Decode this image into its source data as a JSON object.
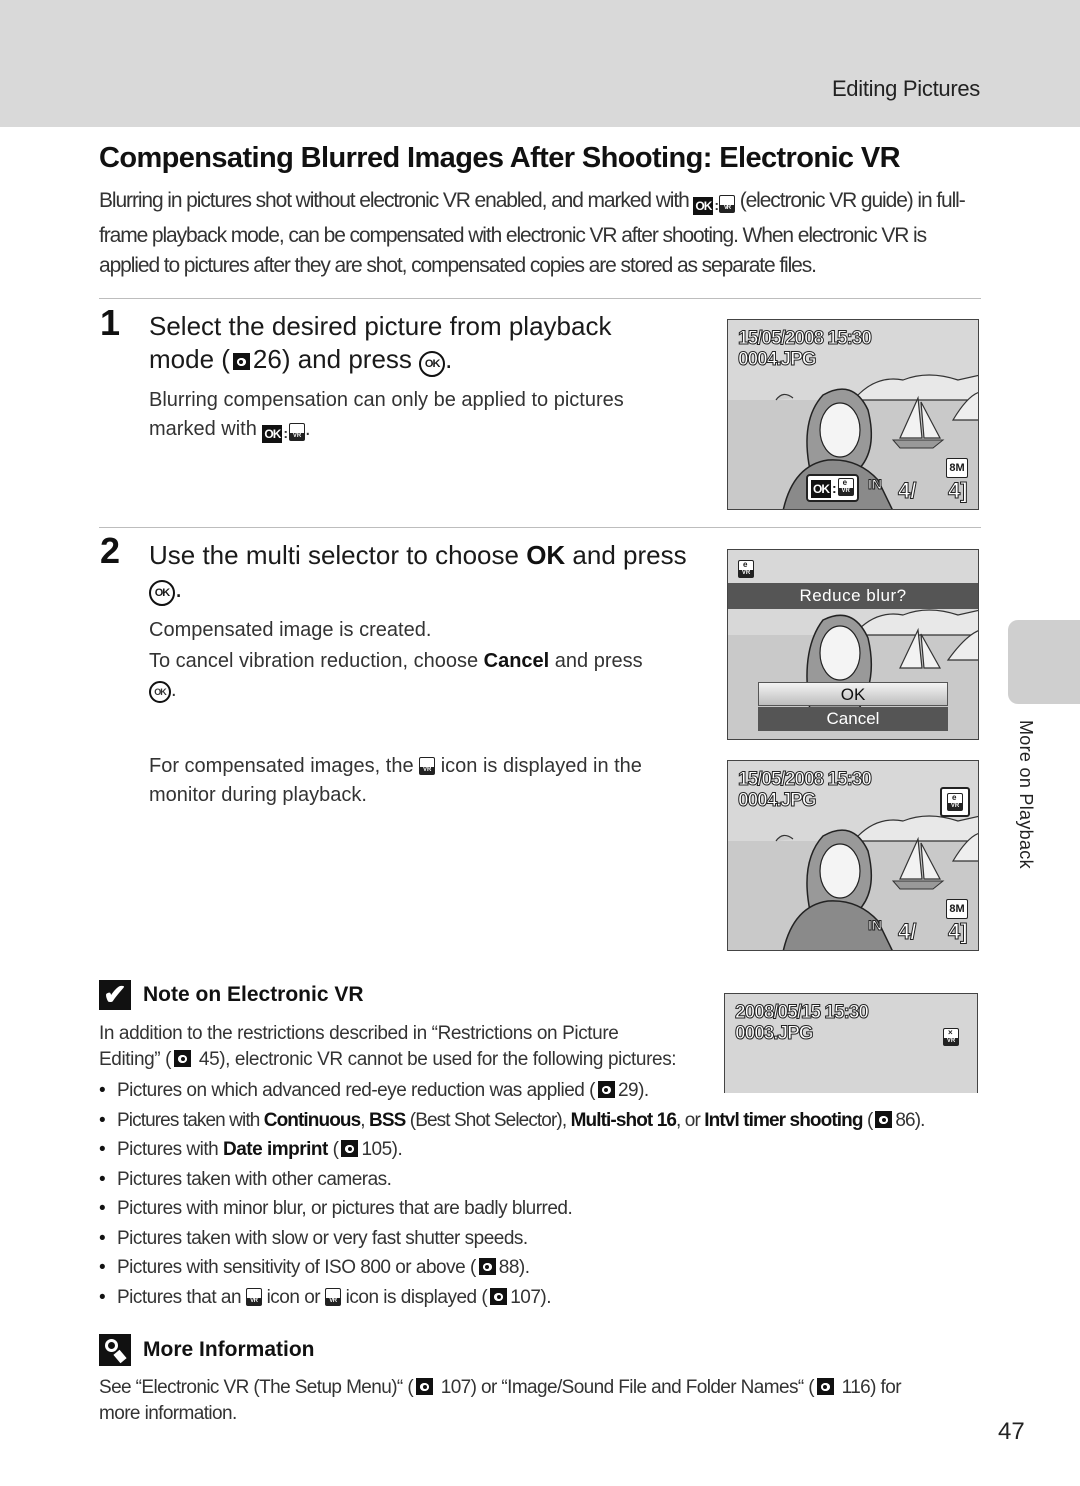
{
  "header": {
    "section": "Editing Pictures"
  },
  "title": "Compensating Blurred Images After Shooting: Electronic VR",
  "intro": {
    "part1": "Blurring in pictures shot without electronic VR enabled, and marked with ",
    "part2": " (electronic VR guide) in full-frame playback mode, can be compensated with electronic VR after shooting. When electronic VR is applied to pictures after they are shot, compensated copies are stored as separate files."
  },
  "icons": {
    "ok_label": "OK",
    "ok_button": "OK",
    "colon": ":"
  },
  "step1": {
    "number": "1",
    "title_a": "Select the desired picture from playback",
    "title_b": "mode (",
    "title_ref": "26",
    "title_c": ") and press ",
    "title_d": ".",
    "text_a": "Blurring compensation can only be applied to pictures",
    "text_b": "marked with ",
    "text_c": "."
  },
  "step2": {
    "number": "2",
    "title_a": "Use the multi selector to choose ",
    "title_bold": "OK",
    "title_b": " and press",
    "title_end": ".",
    "line1": "Compensated image is created.",
    "line2_a": "To cancel vibration reduction, choose ",
    "line2_bold": "Cancel",
    "line2_b": " and press",
    "line2_end": ".",
    "line3_a": "For compensated images, the ",
    "line3_b": " icon is displayed in the",
    "line3_c": "monitor during playback."
  },
  "screens": {
    "screen1": {
      "datetime": "15/05/2008 15:30",
      "filename": "0004.JPG",
      "size": "8M",
      "memory": "IN",
      "counter_current": "4/",
      "counter_total": "4]"
    },
    "screen2": {
      "prompt": "Reduce blur?",
      "options": [
        "OK",
        "Cancel"
      ],
      "selected": "OK"
    },
    "screen3": {
      "datetime": "15/05/2008 15:30",
      "filename": "0004.JPG",
      "size": "8M",
      "memory": "IN",
      "counter_current": "4/",
      "counter_total": "4]"
    },
    "screen4": {
      "datetime": "2008/05/15 15:30",
      "filename": "0003.JPG"
    }
  },
  "note": {
    "heading": "Note on Electronic VR",
    "intro_1": "In addition to the restrictions described in “Restrictions on Picture",
    "intro_2a": "Editing” (",
    "intro_2b": " 45), electronic VR cannot be used for the following pictures:",
    "bullets": [
      {
        "a": "Pictures on which advanced red-eye reduction was applied (",
        "ref": "29",
        "b": ")."
      },
      {
        "a": "Pictures taken with ",
        "b1": "Continuous",
        "c": ", ",
        "b2": "BSS",
        "d": " (Best Shot Selector), ",
        "b3": "Multi-shot 16",
        "e": ", or ",
        "b4": "Intvl timer shooting",
        "f": " (",
        "ref": "86",
        "g": ")."
      },
      {
        "a": "Pictures with ",
        "b1": "Date imprint",
        "c": " (",
        "ref": "105",
        "d": ")."
      },
      {
        "a": "Pictures taken with other cameras."
      },
      {
        "a": "Pictures with minor blur, or pictures that are badly blurred."
      },
      {
        "a": "Pictures taken with slow or very fast shutter speeds."
      },
      {
        "a": "Pictures with sensitivity of ISO 800 or above (",
        "ref": "88",
        "b": ")."
      },
      {
        "a": "Pictures that an ",
        "b": " icon or ",
        "c": " icon is displayed (",
        "ref": "107",
        "d": ")."
      }
    ]
  },
  "more_info": {
    "heading": "More Information",
    "line1_a": "See “Electronic VR (The Setup Menu)“ (",
    "line1_ref1": " 107) or “Image/Sound File and Folder Names“ (",
    "line1_ref2": " 116) for",
    "line2": "more information."
  },
  "side_tab": {
    "label": "More on Playback"
  },
  "page_number": "47"
}
